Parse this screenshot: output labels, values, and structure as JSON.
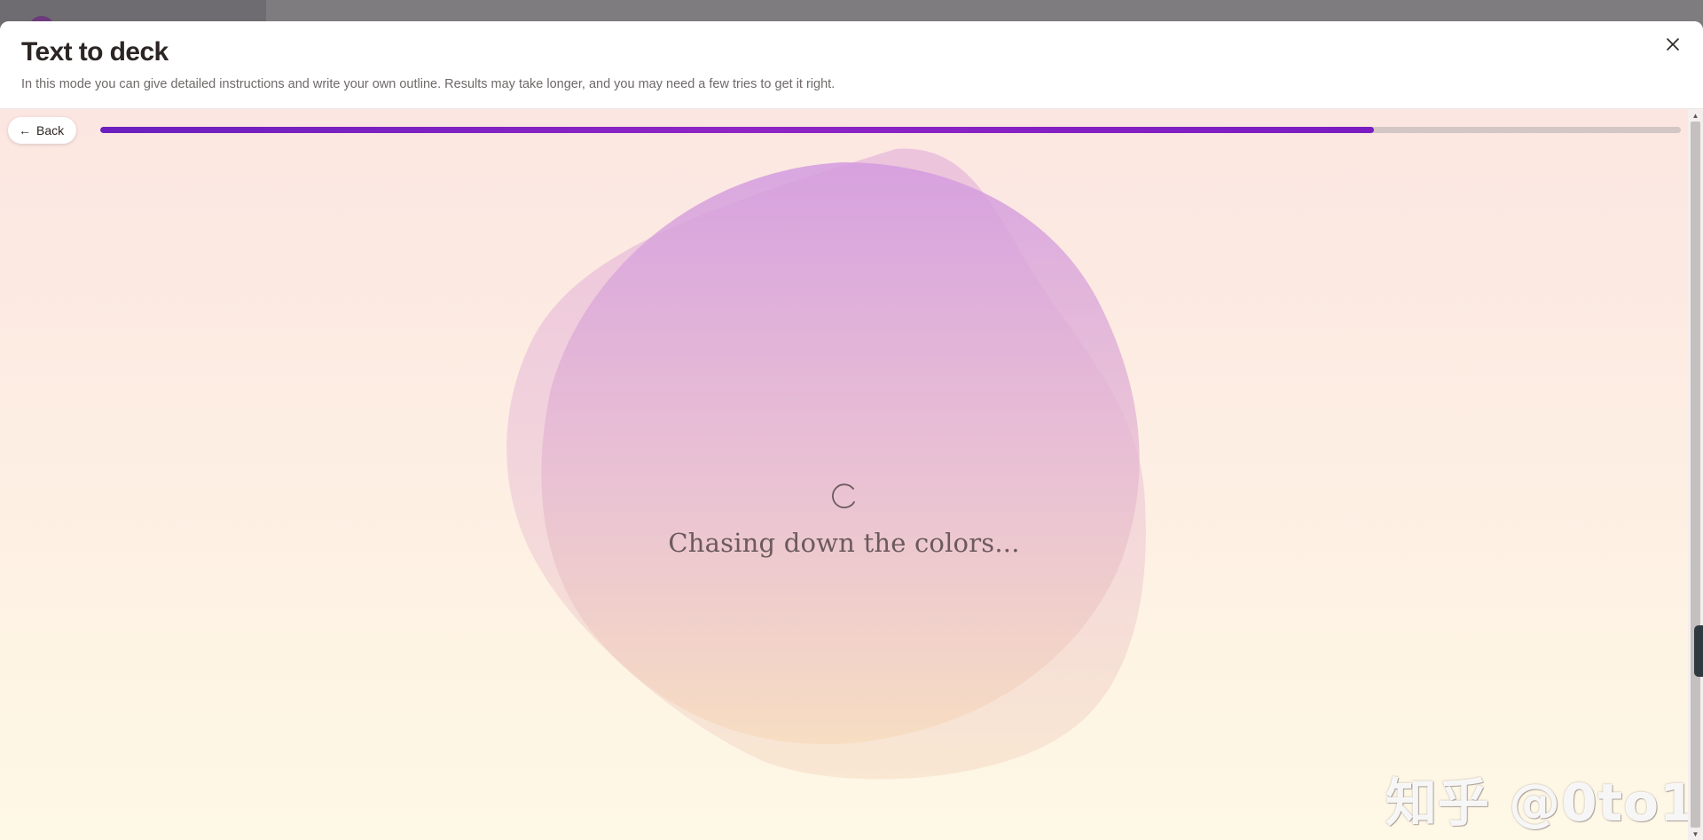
{
  "modal": {
    "title": "Text to deck",
    "description": "In this mode you can give detailed instructions and write your own outline. Results may take longer, and you may need a few tries to get it right.",
    "close_icon": "close-icon"
  },
  "toolbar": {
    "back_label": "Back",
    "back_icon": "arrow-left-icon"
  },
  "progress": {
    "value_percent": 80.6,
    "fill_color": "#7a1cc2",
    "track_color": "#d4c6c5"
  },
  "loading": {
    "message": "Chasing down the colors...",
    "spinner_icon": "spinner-icon"
  },
  "watermark": {
    "text": "知乎 @0to1"
  },
  "colors": {
    "accent": "#7a1cc2",
    "background_top": "#fce6e1",
    "background_bottom": "#fef8e6"
  }
}
